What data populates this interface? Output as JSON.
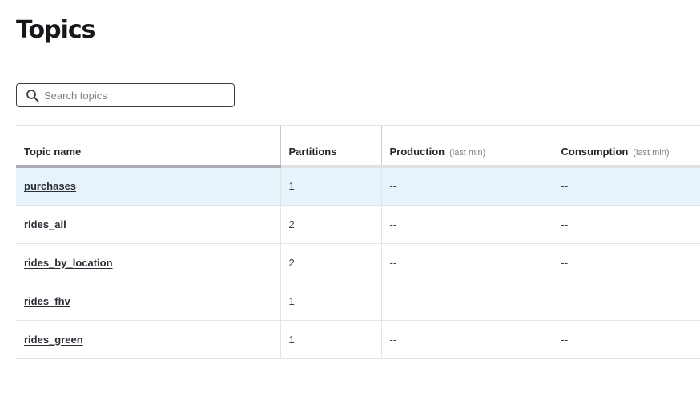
{
  "page": {
    "title": "Topics"
  },
  "search": {
    "placeholder": "Search topics",
    "value": ""
  },
  "table": {
    "columns": {
      "topic_name": "Topic name",
      "partitions": "Partitions",
      "production": "Production",
      "production_sub": "(last min)",
      "consumption": "Consumption",
      "consumption_sub": "(last min)"
    },
    "rows": [
      {
        "name": "purchases",
        "partitions": "1",
        "production": "--",
        "consumption": "--"
      },
      {
        "name": "rides_all",
        "partitions": "2",
        "production": "--",
        "consumption": "--"
      },
      {
        "name": "rides_by_location",
        "partitions": "2",
        "production": "--",
        "consumption": "--"
      },
      {
        "name": "rides_fhv",
        "partitions": "1",
        "production": "--",
        "consumption": "--"
      },
      {
        "name": "rides_green",
        "partitions": "1",
        "production": "--",
        "consumption": "--"
      }
    ]
  },
  "colors": {
    "highlight_row": "#e6f3fb",
    "text": "#1f2226"
  }
}
